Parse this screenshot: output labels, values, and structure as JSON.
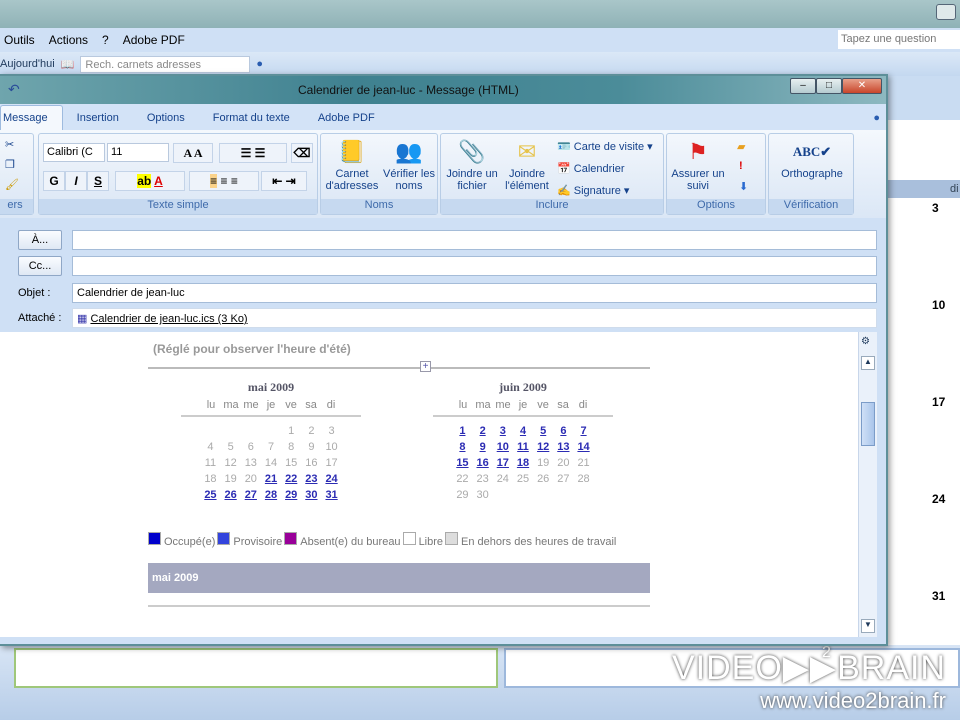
{
  "outlook": {
    "menu": [
      "Outils",
      "Actions",
      "?",
      "Adobe PDF"
    ],
    "ask_placeholder": "Tapez une question",
    "today_button": "Aujourd'hui",
    "search_placeholder": "Rech. carnets adresses",
    "calendar_days": [
      "3",
      "10",
      "17",
      "24",
      "31"
    ],
    "calendar_header": "di",
    "watermark": {
      "brand": "VIDEO▶▶BRAIN",
      "sup": "2",
      "url": "www.video2brain.fr"
    }
  },
  "window": {
    "title": "Calendrier de jean-luc - Message (HTML)",
    "tabs": [
      "Message",
      "Insertion",
      "Options",
      "Format du texte",
      "Adobe PDF"
    ],
    "ribbon": {
      "clipboard_label": "ers",
      "font": "Calibri (C",
      "size": "11",
      "format_buttons": [
        "G",
        "I",
        "S"
      ],
      "texte_simple": "Texte simple",
      "noms": {
        "label": "Noms",
        "carnet": "Carnet d'adresses",
        "verifier": "Vérifier les noms"
      },
      "inclure": {
        "label": "Inclure",
        "fichier": "Joindre un fichier",
        "element": "Joindre l'élément",
        "carte": "Carte de visite",
        "calendrier": "Calendrier",
        "signature": "Signature"
      },
      "options": {
        "label": "Options",
        "suivi": "Assurer un suivi"
      },
      "verification": {
        "label": "Vérification",
        "ortho": "Orthographe"
      }
    },
    "fields": {
      "to_button": "À...",
      "cc_button": "Cc...",
      "to": "",
      "cc": "",
      "subject_label": "Objet :",
      "subject": "Calendrier de jean-luc",
      "attach_label": "Attaché :",
      "attachment": "Calendrier de jean-luc.ics (3 Ko)"
    },
    "body": {
      "dst_note": "(Réglé pour observer l'heure d'été)",
      "weekdays": [
        "lu",
        "ma",
        "me",
        "je",
        "ve",
        "sa",
        "di"
      ],
      "months": [
        {
          "title": "mai 2009",
          "offset": 4,
          "days": 31,
          "linked_from": 21,
          "linked_to": 31
        },
        {
          "title": "juin 2009",
          "offset": 0,
          "days": 30,
          "linked_from": 1,
          "linked_to": 18
        }
      ],
      "legend": [
        {
          "label": "Occupé(e)",
          "color": "#0000cc"
        },
        {
          "label": "Provisoire",
          "color": "#3344dd"
        },
        {
          "label": "Absent(e) du bureau",
          "color": "#990099"
        },
        {
          "label": "Libre",
          "color": "#ffffff"
        },
        {
          "label": "En dehors des heures de travail",
          "color": "#dddddd"
        }
      ],
      "month_bar": "mai 2009"
    }
  }
}
